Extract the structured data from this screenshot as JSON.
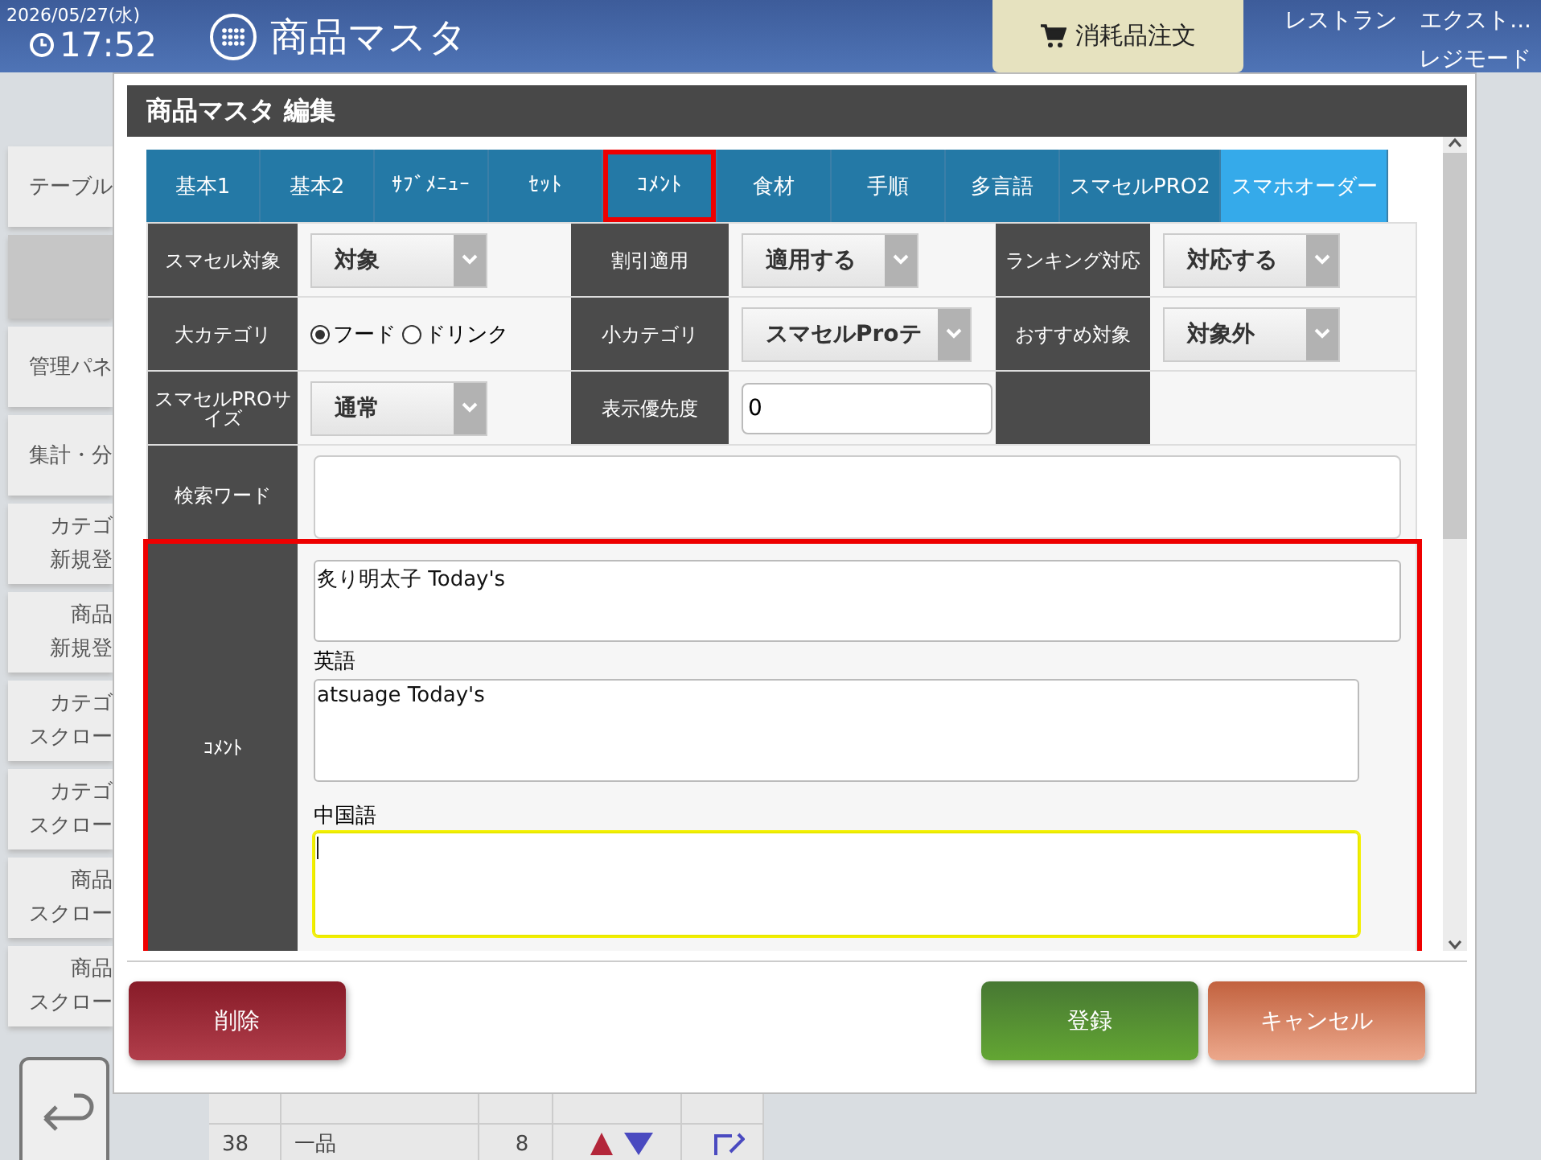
{
  "header": {
    "date": "2026/05/27(水)",
    "time": "17:52",
    "title": "商品マスタ",
    "order_button": "消耗品注文",
    "store": "レストラン　エクスト...",
    "mode": "レジモード"
  },
  "sidebar": {
    "items": [
      {
        "lines": [
          "テーブル"
        ],
        "selected": false
      },
      {
        "selected": true
      },
      {
        "lines": [
          "管理パネ"
        ],
        "selected": false
      },
      {
        "lines": [
          "集計・分"
        ],
        "selected": false
      },
      {
        "lines": [
          "カテゴ",
          "新規登"
        ],
        "selected": false
      },
      {
        "lines": [
          "商品",
          "新規登"
        ],
        "selected": false
      },
      {
        "lines": [
          "カテゴ",
          "スクロー"
        ],
        "selected": false
      },
      {
        "lines": [
          "カテゴ",
          "スクロー"
        ],
        "selected": false
      },
      {
        "lines": [
          "商品",
          "スクロー"
        ],
        "selected": false
      },
      {
        "lines": [
          "商品",
          "スクロー"
        ],
        "selected": false
      }
    ]
  },
  "table_rows": [
    {
      "cells": [
        "38",
        "一品",
        "8"
      ]
    }
  ],
  "dialog": {
    "title": "商品マスタ 編集",
    "tabs": [
      {
        "label": "基本1",
        "selected": false,
        "highlighted": false
      },
      {
        "label": "基本2",
        "selected": false,
        "highlighted": false
      },
      {
        "label": "ｻﾌﾞﾒﾆｭｰ",
        "selected": false,
        "highlighted": false
      },
      {
        "label": "ｾｯﾄ",
        "selected": false,
        "highlighted": false
      },
      {
        "label": "ｺﾒﾝﾄ",
        "selected": false,
        "highlighted": true
      },
      {
        "label": "食材",
        "selected": false,
        "highlighted": false
      },
      {
        "label": "手順",
        "selected": false,
        "highlighted": false
      },
      {
        "label": "多言語",
        "selected": false,
        "highlighted": false
      },
      {
        "label": "スマセルPRO2",
        "selected": false,
        "highlighted": false
      },
      {
        "label": "スマホオーダー",
        "selected": true,
        "highlighted": false
      }
    ],
    "rows": [
      [
        {
          "label": "スマセル対象",
          "kind": "select",
          "value": "対象"
        },
        {
          "label": "割引適用",
          "kind": "select",
          "value": "適用する"
        },
        {
          "label": "ランキング対応",
          "kind": "select",
          "value": "対応する"
        }
      ],
      [
        {
          "label": "大カテゴリ",
          "kind": "radio",
          "options": [
            {
              "label": "フード",
              "selected": true
            },
            {
              "label": "ドリンク",
              "selected": false
            }
          ]
        },
        {
          "label": "小カテゴリ",
          "kind": "select",
          "value": "スマセルProテ"
        },
        {
          "label": "おすすめ対象",
          "kind": "select",
          "value": "対象外"
        }
      ],
      [
        {
          "label": "スマセルPROサイズ",
          "kind": "select",
          "value": "通常"
        },
        {
          "label": "表示優先度",
          "kind": "input",
          "value": "0"
        },
        {
          "kind": "blank"
        }
      ]
    ],
    "search": {
      "label": "検索ワード"
    },
    "comment": {
      "label": "ｺﾒﾝﾄ",
      "highlighted": true,
      "entries": [
        {
          "value": "炙り明太子 Today's",
          "focused": false
        },
        {
          "label": "英語",
          "value": "atsuage Today's",
          "focused": false
        },
        {
          "label": "中国語",
          "focused": true
        }
      ]
    },
    "buttons": [
      {
        "label": "削除",
        "kind": "delete"
      },
      {
        "label": "登録",
        "kind": "save"
      },
      {
        "label": "キャンセル",
        "kind": "cancel"
      }
    ]
  }
}
